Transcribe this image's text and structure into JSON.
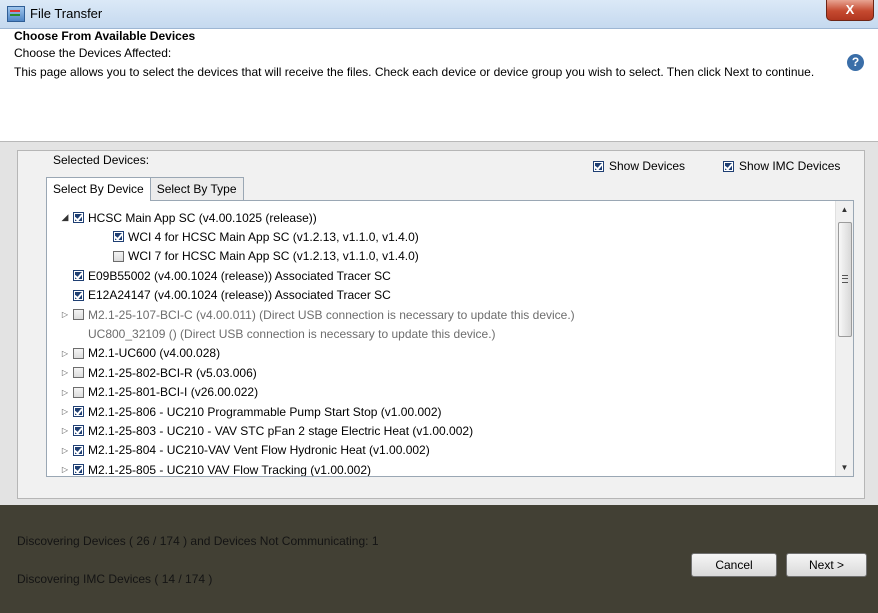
{
  "window": {
    "title": "File Transfer",
    "close_label": "X"
  },
  "header": {
    "title": "Choose From Available Devices",
    "subtitle": "Choose the Devices Affected:",
    "description": "This page allows you to select the devices that will receive the files. Check each device or device group you wish to select. Then click Next to continue.",
    "help_label": "?"
  },
  "selection": {
    "label": "Selected Devices:",
    "show_devices": {
      "label": "Show Devices",
      "checked": true
    },
    "show_imc_devices": {
      "label": "Show IMC Devices",
      "checked": true
    }
  },
  "tabs": [
    {
      "label": "Select By Device",
      "active": true
    },
    {
      "label": "Select By Type",
      "active": false
    }
  ],
  "tree": [
    {
      "label": "HCSC Main App SC (v4.00.1025 (release))",
      "checked": true,
      "expander": "open",
      "level": 0,
      "enabled": true
    },
    {
      "label": "WCI 4 for HCSC Main App SC (v1.2.13, v1.1.0, v1.4.0)",
      "checked": true,
      "expander": "none",
      "level": 1,
      "enabled": true
    },
    {
      "label": "WCI 7 for HCSC Main App SC (v1.2.13, v1.1.0, v1.4.0)",
      "checked": false,
      "expander": "none",
      "level": 1,
      "enabled": true
    },
    {
      "label": "E09B55002 (v4.00.1024 (release)) Associated Tracer SC",
      "checked": true,
      "expander": "none",
      "level": 0,
      "enabled": true
    },
    {
      "label": "E12A24147 (v4.00.1024 (release)) Associated Tracer SC",
      "checked": true,
      "expander": "none",
      "level": 0,
      "enabled": true
    },
    {
      "label": "M2.1-25-107-BCI-C (v4.00.011) (Direct USB connection is necessary to update this device.)",
      "checked": false,
      "expander": "closed",
      "level": 0,
      "enabled": false
    },
    {
      "label": "UC800_32109 () (Direct USB connection is necessary to update this device.)",
      "checked": null,
      "expander": "none",
      "level": 0,
      "enabled": false
    },
    {
      "label": "M2.1-UC600 (v4.00.028)",
      "checked": false,
      "expander": "closed",
      "level": 0,
      "enabled": true
    },
    {
      "label": "M2.1-25-802-BCI-R (v5.03.006)",
      "checked": false,
      "expander": "closed",
      "level": 0,
      "enabled": true
    },
    {
      "label": "M2.1-25-801-BCI-I (v26.00.022)",
      "checked": false,
      "expander": "closed",
      "level": 0,
      "enabled": true
    },
    {
      "label": "M2.1-25-806 - UC210 Programmable Pump Start Stop (v1.00.002)",
      "checked": true,
      "expander": "closed",
      "level": 0,
      "enabled": true
    },
    {
      "label": "M2.1-25-803 - UC210 - VAV STC pFan 2 stage Electric Heat (v1.00.002)",
      "checked": true,
      "expander": "closed",
      "level": 0,
      "enabled": true
    },
    {
      "label": "M2.1-25-804 - UC210-VAV Vent Flow Hydronic Heat (v1.00.002)",
      "checked": true,
      "expander": "closed",
      "level": 0,
      "enabled": true
    },
    {
      "label": "M2.1-25-805 - UC210 VAV Flow Tracking (v1.00.002)",
      "checked": true,
      "expander": "closed",
      "level": 0,
      "enabled": true
    }
  ],
  "status": {
    "discovering_devices": "Discovering Devices ( 26 / 174 ) and Devices Not Communicating: 1",
    "discovering_imc": "Discovering IMC Devices ( 14 / 174 )"
  },
  "buttons": {
    "cancel": "Cancel",
    "next": "Next >"
  }
}
